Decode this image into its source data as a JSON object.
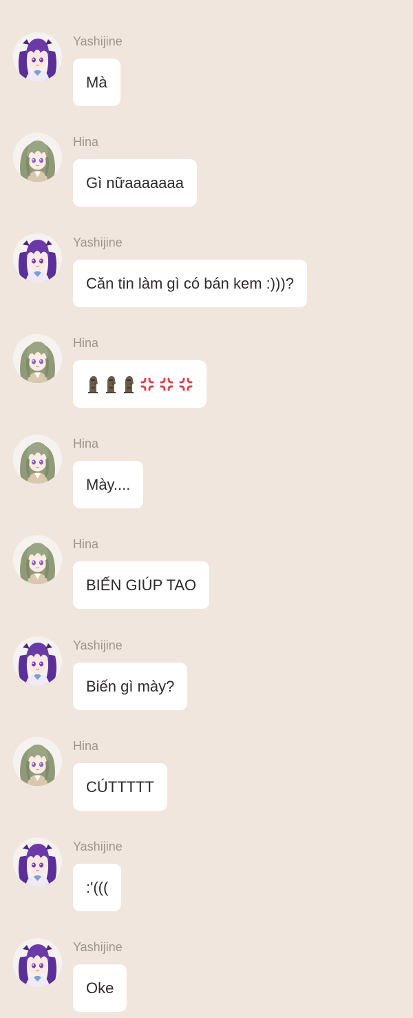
{
  "chat": {
    "messages": [
      {
        "sender": "Yashijine",
        "avatar": "yashijine-avatar",
        "text": "Mà"
      },
      {
        "sender": "Hina",
        "avatar": "hina-avatar",
        "text": "Gì nữaaaaaaa"
      },
      {
        "sender": "Yashijine",
        "avatar": "yashijine-avatar",
        "text": "Căn tin làm gì có bán kem :)))?"
      },
      {
        "sender": "Hina",
        "avatar": "hina-avatar",
        "emoji": [
          "moai",
          "moai",
          "moai",
          "anger-symbol",
          "anger-symbol",
          "anger-symbol"
        ]
      },
      {
        "sender": "Hina",
        "avatar": "hina-avatar",
        "text": "Mày...."
      },
      {
        "sender": "Hina",
        "avatar": "hina-avatar",
        "text": "BIẾN GIÚP TAO"
      },
      {
        "sender": "Yashijine",
        "avatar": "yashijine-avatar",
        "text": "Biến gì mày?"
      },
      {
        "sender": "Hina",
        "avatar": "hina-avatar",
        "text": "CÚTTTTT"
      },
      {
        "sender": "Yashijine",
        "avatar": "yashijine-avatar",
        "text": ":'((("
      },
      {
        "sender": "Yashijine",
        "avatar": "yashijine-avatar",
        "text": "Oke"
      }
    ]
  },
  "colors": {
    "background": "#f1e6de",
    "bubble": "#ffffff",
    "sender_name": "#9a9591",
    "message_text": "#2f2b29",
    "yashijine_hair": "#6a3aa8",
    "hina_hair": "#8f9a78"
  }
}
